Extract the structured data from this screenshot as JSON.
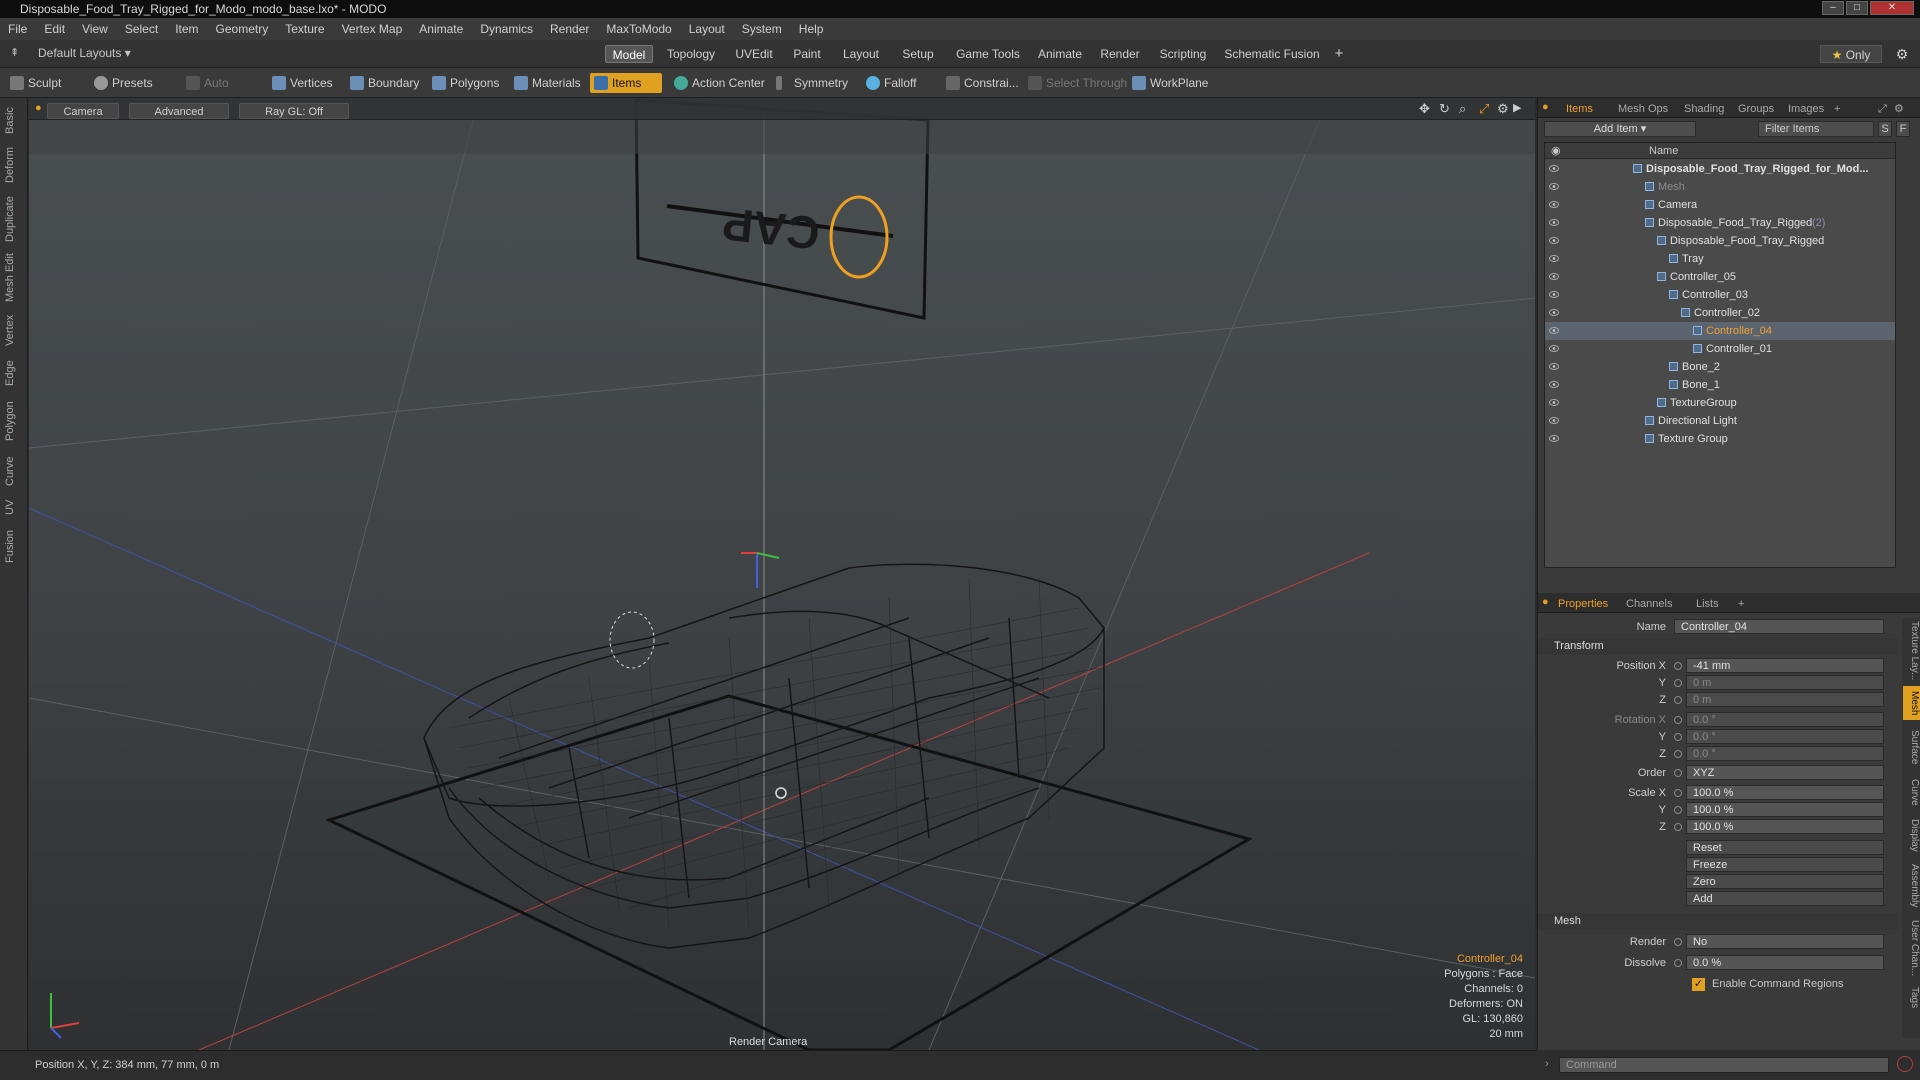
{
  "window": {
    "title": "Disposable_Food_Tray_Rigged_for_Modo_modo_base.lxo* - MODO"
  },
  "menu": [
    "File",
    "Edit",
    "View",
    "Select",
    "Item",
    "Geometry",
    "Texture",
    "Vertex Map",
    "Animate",
    "Dynamics",
    "Render",
    "MaxToModo",
    "Layout",
    "System",
    "Help"
  ],
  "modebar": {
    "layouts": "Default Layouts ▾",
    "tabs": [
      "Model",
      "Topology",
      "UVEdit",
      "Paint",
      "Layout",
      "Setup",
      "Game Tools",
      "Animate",
      "Render",
      "Scripting",
      "Schematic Fusion"
    ],
    "active": "Model",
    "only": "Only"
  },
  "toolbar": {
    "sculpt": "Sculpt",
    "presets": "Presets",
    "auto_select": "Auto Select",
    "vertices": "Vertices",
    "boundary": "Boundary",
    "polygons": "Polygons",
    "materials": "Materials",
    "items": "Items",
    "action_center": "Action Center",
    "symmetry": "Symmetry",
    "falloff": "Falloff",
    "constraints": "Constrai...",
    "select_through": "Select Through",
    "workplane": "WorkPlane"
  },
  "leftstrip": [
    "Basic",
    "Deform",
    "Duplicate",
    "Mesh Edit",
    "Vertex",
    "Edge",
    "Polygon",
    "Curve",
    "UV",
    "Fusion"
  ],
  "viewport": {
    "camera": "Camera",
    "advanced": "Advanced",
    "raygl": "Ray GL: Off",
    "render_camera": "Render Camera",
    "sign_text": "CAP",
    "info": {
      "selected": "Controller_04",
      "polygons": "Polygons : Face",
      "channels": "Channels: 0",
      "deformers": "Deformers: ON",
      "gl": "GL: 130,860",
      "scale": "20 mm"
    }
  },
  "items_panel": {
    "tabs": [
      "Items",
      "Mesh Ops",
      "Shading",
      "Groups",
      "Images"
    ],
    "active_tab": "Items",
    "add_item": "Add Item",
    "filter": "Filter Items",
    "col_name": "Name",
    "rows": [
      {
        "label": "Disposable_Food_Tray_Rigged_for_Mod...",
        "indent": 0,
        "bold": true
      },
      {
        "label": "Mesh",
        "indent": 1,
        "dim": true
      },
      {
        "label": "Camera",
        "indent": 1
      },
      {
        "label": "Disposable_Food_Tray_Rigged",
        "suffix": "(2)",
        "indent": 1
      },
      {
        "label": "Disposable_Food_Tray_Rigged",
        "indent": 2
      },
      {
        "label": "Tray",
        "indent": 3
      },
      {
        "label": "Controller_05",
        "indent": 2
      },
      {
        "label": "Controller_03",
        "indent": 3
      },
      {
        "label": "Controller_02",
        "indent": 4
      },
      {
        "label": "Controller_04",
        "indent": 5,
        "selected": true
      },
      {
        "label": "Controller_01",
        "indent": 5
      },
      {
        "label": "Bone_2",
        "indent": 3
      },
      {
        "label": "Bone_1",
        "indent": 3
      },
      {
        "label": "TextureGroup",
        "indent": 2
      },
      {
        "label": "Directional Light",
        "indent": 1
      },
      {
        "label": "Texture Group",
        "indent": 1
      }
    ]
  },
  "properties": {
    "tabs": [
      "Properties",
      "Channels",
      "Lists"
    ],
    "active_tab": "Properties",
    "name_label": "Name",
    "name_value": "Controller_04",
    "transform_label": "Transform",
    "pos_x_label": "Position X",
    "pos_x": "-41 mm",
    "pos_y": "0 m",
    "pos_z": "0 m",
    "rot_x_label": "Rotation X",
    "rot_x": "0.0 °",
    "rot_y": "0.0 °",
    "rot_z": "0.0 °",
    "order_label": "Order",
    "order": "XYZ",
    "scale_x_label": "Scale X",
    "scale_x": "100.0 %",
    "scale_y": "100.0 %",
    "scale_z": "100.0 %",
    "y": "Y",
    "z": "Z",
    "reset": "Reset",
    "freeze": "Freeze",
    "zero": "Zero",
    "add": "Add",
    "mesh_label": "Mesh",
    "render_label": "Render",
    "render": "No",
    "dissolve_label": "Dissolve",
    "dissolve": "0.0 %",
    "enable_cmd": "Enable Command Regions"
  },
  "rightstrip": [
    "Texture Lay...",
    "Mesh",
    "Surface",
    "Curve",
    "Display",
    "Assembly",
    "User Chan...",
    "Tags"
  ],
  "status": {
    "text": "Position X, Y, Z:   384 mm, 77 mm, 0 m"
  },
  "command": {
    "placeholder": "Command"
  }
}
